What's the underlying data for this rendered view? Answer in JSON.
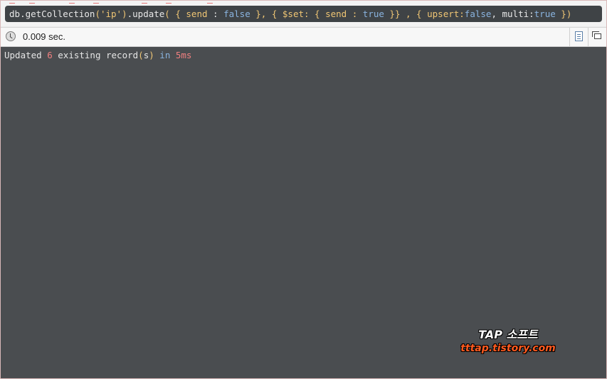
{
  "query": {
    "db": "db",
    "dot1": ".",
    "get_collection": "getCollection",
    "open_paren1": "(",
    "collection_name": "'ip'",
    "close_paren1": ")",
    "dot2": ".",
    "update": "update",
    "open_paren2": "(",
    "filter_open": " { send ",
    "filter_colon": ": ",
    "filter_value": "false",
    "filter_close": " }, { $set: { send : ",
    "set_value": "true",
    "set_close": " }} , { upsert:",
    "upsert_value": "false",
    "multi_label": ", multi:",
    "multi_value": "true",
    "options_close": " }",
    "close_paren2": ")"
  },
  "status": {
    "elapsed": "0.009 sec."
  },
  "result": {
    "prefix": "Updated ",
    "count": "6",
    "middle": " existing record",
    "open_paren": "(",
    "plural": "s",
    "close_paren": ")",
    "in_word": " in ",
    "duration": "5ms"
  },
  "watermark": {
    "title": "TAP 소프트",
    "site": "tttap.tistory.com"
  },
  "icons": {
    "clock": "clock-icon",
    "text_view": "text-view-icon",
    "window": "window-restore-icon"
  },
  "colors": {
    "results_background": "#4a4d50",
    "query_background": "#3f4346",
    "keyword_blue": "#8ab4e0",
    "string_yellow": "#f0c674",
    "number_red": "#f08080",
    "watermark_orange": "#ff5a1f"
  }
}
